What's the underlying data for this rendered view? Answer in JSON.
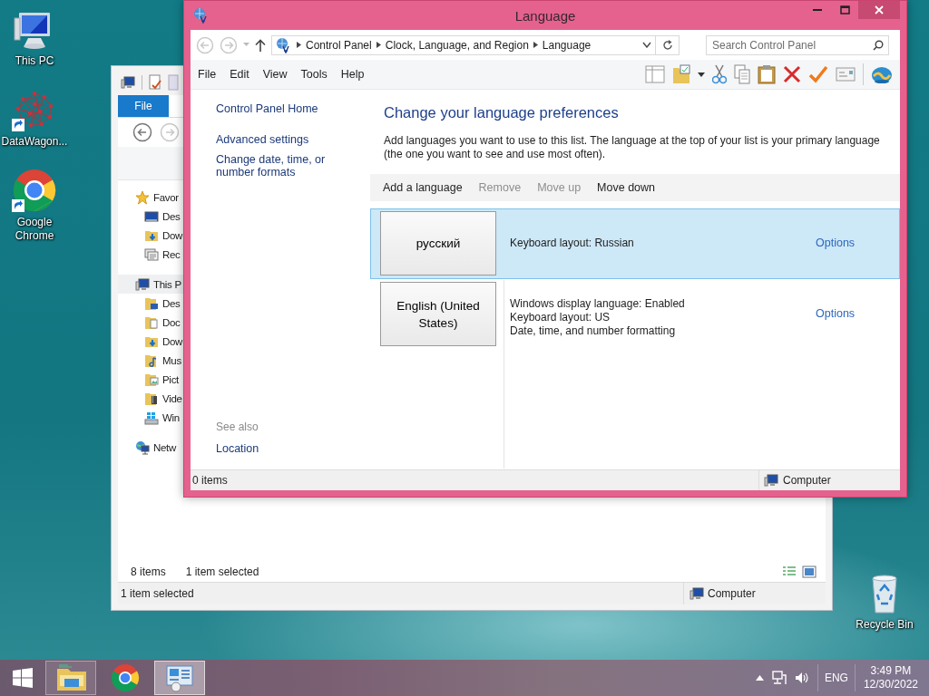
{
  "desktop_icons": [
    {
      "label": "This PC",
      "kind": "computer",
      "shortcut": false
    },
    {
      "label": "DataWagon...",
      "kind": "network-graph",
      "shortcut": true
    },
    {
      "label": "Google Chrome",
      "kind": "chrome",
      "shortcut": true
    }
  ],
  "recycle_bin": {
    "label": "Recycle Bin"
  },
  "explorer_window": {
    "file_tab": "File",
    "nav_pane": [
      {
        "label": "Favor",
        "kind": "star",
        "selected": false,
        "children": [
          {
            "label": "Des",
            "kind": "desktop",
            "selected": false
          },
          {
            "label": "Dow",
            "kind": "downloads",
            "selected": false
          },
          {
            "label": "Rec",
            "kind": "recent",
            "selected": false
          }
        ]
      },
      {
        "label": "This P",
        "kind": "computer",
        "selected": true,
        "children": [
          {
            "label": "Des",
            "kind": "desktop-folder",
            "selected": false
          },
          {
            "label": "Doc",
            "kind": "documents",
            "selected": false
          },
          {
            "label": "Dow",
            "kind": "downloads",
            "selected": false
          },
          {
            "label": "Mus",
            "kind": "music",
            "selected": false
          },
          {
            "label": "Pict",
            "kind": "pictures",
            "selected": false
          },
          {
            "label": "Vide",
            "kind": "videos",
            "selected": false
          },
          {
            "label": "Win",
            "kind": "drive",
            "selected": false
          }
        ]
      },
      {
        "label": "Netw",
        "kind": "network",
        "selected": false
      }
    ],
    "item_count": "8 items",
    "selection_count": "1 item selected",
    "status_bar": {
      "text": "1 item selected",
      "location": "Computer"
    }
  },
  "language_window": {
    "title": "Language",
    "breadcrumb": [
      "Control Panel",
      "Clock, Language, and Region",
      "Language"
    ],
    "search": {
      "placeholder": "Search Control Panel"
    },
    "menu": [
      "File",
      "Edit",
      "View",
      "Tools",
      "Help"
    ],
    "sidebar_links": [
      "Control Panel Home",
      "Advanced settings",
      "Change date, time, or number formats"
    ],
    "see_also": {
      "heading": "See also",
      "links": [
        "Location"
      ]
    },
    "heading": "Change your language preferences",
    "description": "Add languages you want to use to this list. The language at the top of your list is your primary language (the one you want to see and use most often).",
    "toolbar": [
      {
        "label": "Add a language",
        "disabled": false
      },
      {
        "label": "Remove",
        "disabled": true
      },
      {
        "label": "Move up",
        "disabled": true
      },
      {
        "label": "Move down",
        "disabled": false
      }
    ],
    "languages": [
      {
        "name": "русский",
        "details": [
          "Keyboard layout: Russian"
        ],
        "options": "Options",
        "selected": true
      },
      {
        "name": "English (United States)",
        "details": [
          "Windows display language: Enabled",
          "Keyboard layout: US",
          "Date, time, and number formatting"
        ],
        "options": "Options",
        "selected": false
      }
    ],
    "status_bar": {
      "items": "0 items",
      "location": "Computer"
    }
  },
  "taskbar": {
    "apps": [
      {
        "kind": "explorer",
        "running": true,
        "active": false
      },
      {
        "kind": "chrome",
        "running": false,
        "active": false
      },
      {
        "kind": "control-panel",
        "running": true,
        "active": true
      }
    ],
    "language": "ENG",
    "time": "3:49 PM",
    "date": "12/30/2022"
  }
}
